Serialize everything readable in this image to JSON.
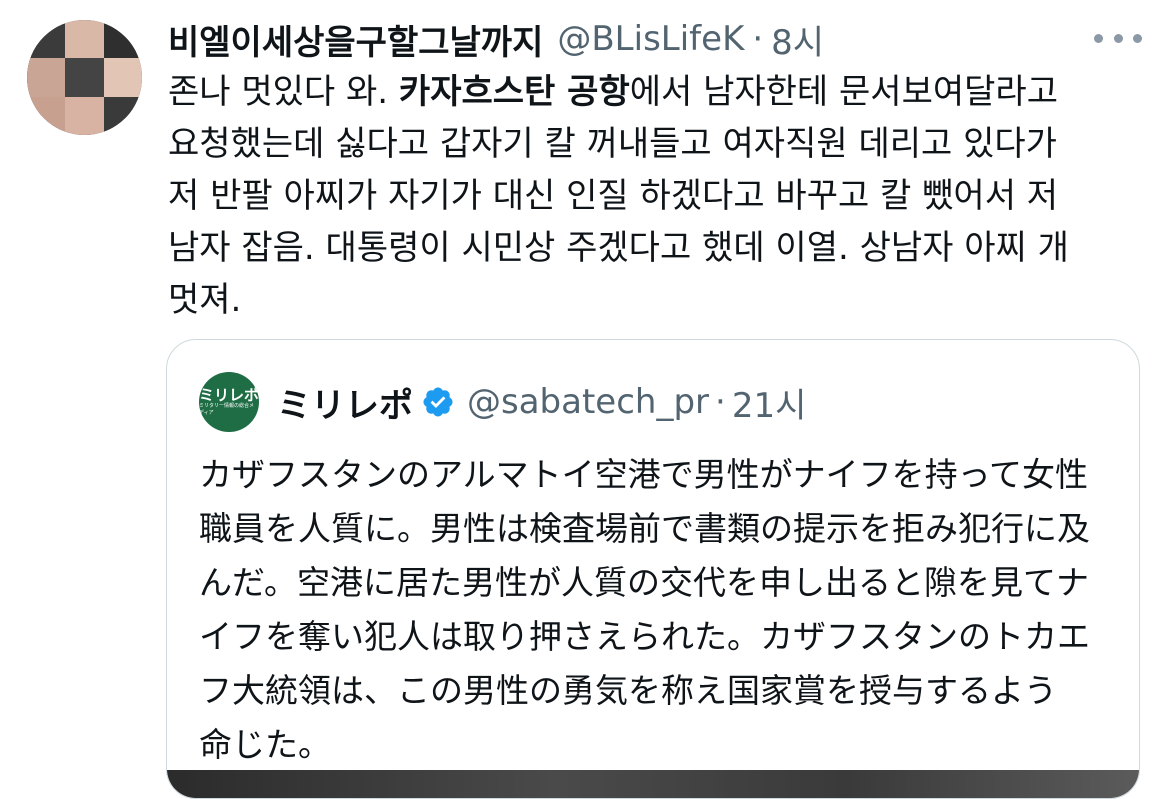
{
  "tweet": {
    "display_name": "비엘이세상을구할그날까지",
    "handle": "@BLisLifeK",
    "separator": "·",
    "time": "8시",
    "text_before_bold": "존나 멋있다 와. ",
    "text_bold": "카자흐스탄 공항",
    "text_after_bold": "에서 남자한테 문서보여달라고\n요청했는데 싫다고 갑자기 칼 꺼내들고 여자직원 데리고 있다가\n저 반팔 아찌가 자기가 대신 인질 하겠다고 바꾸고 칼 뺐어서 저\n남자 잡음. 대통령이 시민상 주겠다고 했데 이열. 상남자 아찌 개\n멋져."
  },
  "quoted_tweet": {
    "avatar_logo_text": "ミリレポ",
    "avatar_logo_subtext": "ミリタリー情報の総合メディア",
    "display_name": "ミリレポ",
    "handle": "@sabatech_pr",
    "separator": "·",
    "time": "21시",
    "text": "カザフスタンのアルマトイ空港で男性がナイフを持って女性\n職員を人質に。男性は検査場前で書類の提示を拒み犯行に及\nんだ。空港に居た男性が人質の交代を申し出ると隙を見てナ\nイフを奪い犯人は取り押さえられた。カザフスタンのトカエ\nフ大統領は、この男性の勇気を称え国家賞を授与するよう\n命じた。"
  },
  "icons": {
    "more": "more-horizontal-icon",
    "verified": "verified-badge-icon"
  },
  "colors": {
    "text_primary": "#0f1419",
    "text_secondary": "#536471",
    "verified_blue": "#1d9bf0",
    "border": "#cfd9de",
    "quote_avatar_green": "#1f6d45"
  }
}
